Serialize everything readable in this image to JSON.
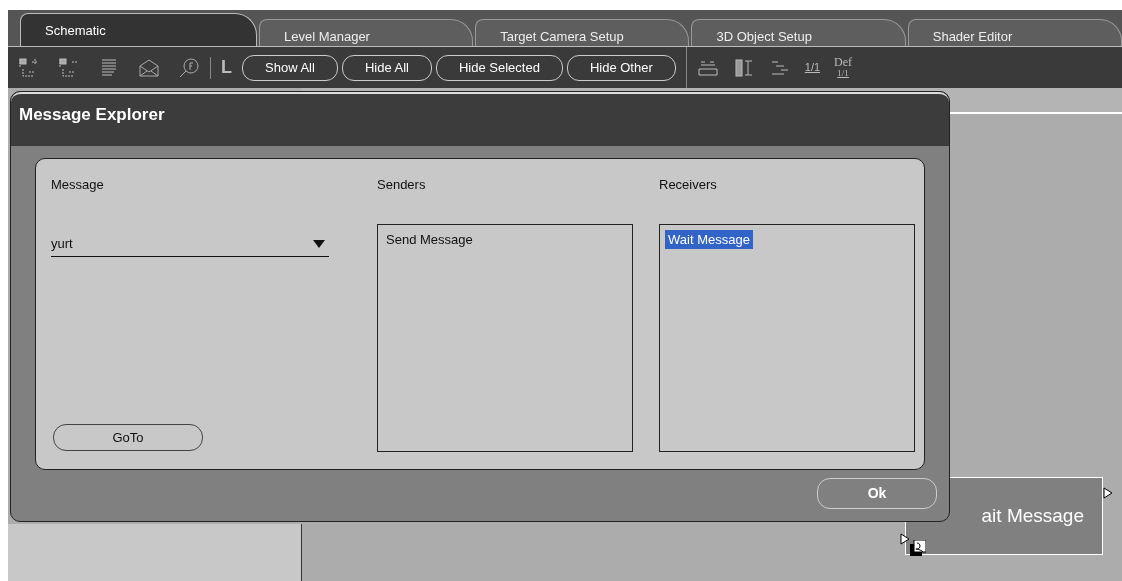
{
  "tabs": [
    {
      "label": "Schematic",
      "selected": true
    },
    {
      "label": "Level Manager",
      "selected": false
    },
    {
      "label": "Target Camera Setup",
      "selected": false
    },
    {
      "label": "3D Object Setup",
      "selected": false
    },
    {
      "label": "Shader Editor",
      "selected": false
    }
  ],
  "toolbar": {
    "glyph": "L",
    "buttons": [
      "Show All",
      "Hide All",
      "Hide Selected",
      "Hide Other"
    ],
    "ratio": "1/1",
    "def_label": "Def",
    "def_ratio": "1/1"
  },
  "dialog": {
    "title": "Message Explorer",
    "message": {
      "label": "Message",
      "value": "yurt"
    },
    "senders": {
      "label": "Senders",
      "items": [
        {
          "label": "Send Message",
          "selected": false
        }
      ]
    },
    "receivers": {
      "label": "Receivers",
      "items": [
        {
          "label": "Wait Message",
          "selected": true
        }
      ]
    },
    "goto_button": "GoTo",
    "ok_button": "Ok"
  },
  "canvas": {
    "node": {
      "label": "ait Message"
    }
  }
}
